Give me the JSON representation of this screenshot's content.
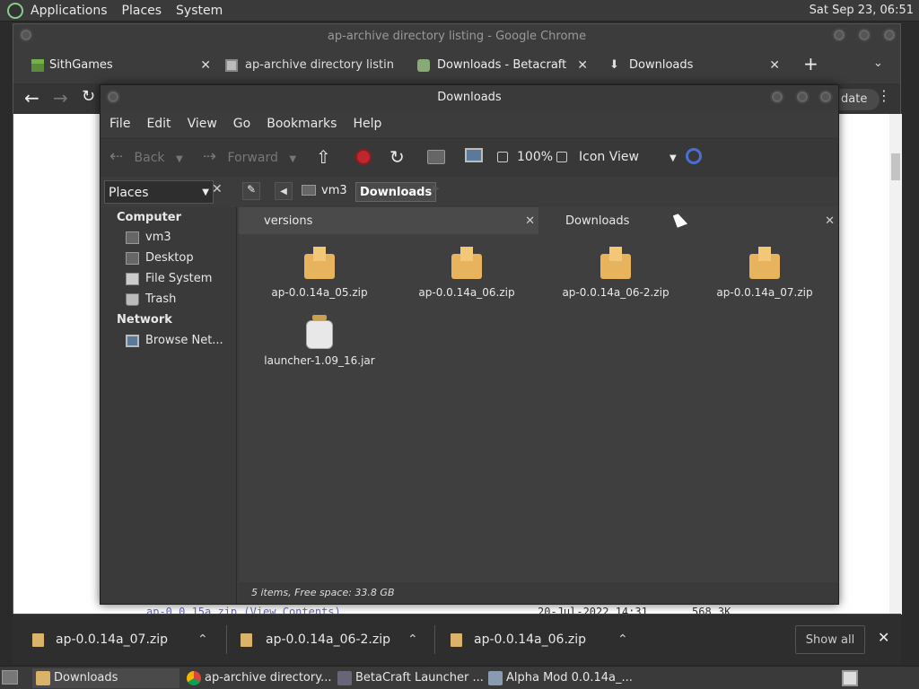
{
  "top_panel": {
    "menus": [
      "Applications",
      "Places",
      "System"
    ],
    "clock": "Sat Sep 23, 06:51"
  },
  "chrome": {
    "title": "ap-archive directory listing - Google Chrome",
    "tabs": [
      {
        "label": "SithGames",
        "icon": "minecraft-block-icon"
      },
      {
        "label": "ap-archive directory listin",
        "icon": "archive-icon"
      },
      {
        "label": "Downloads - Betacraft",
        "icon": "betacraft-icon"
      },
      {
        "label": "Downloads",
        "icon": "download-icon"
      }
    ],
    "update_label": "date",
    "page_peek": {
      "link": "ap-0.0.15a.zip (View Contents)",
      "date": "20-Jul-2022 14:31",
      "size": "568.3K"
    }
  },
  "downloads_bar": {
    "items": [
      "ap-0.0.14a_07.zip",
      "ap-0.0.14a_06-2.zip",
      "ap-0.0.14a_06.zip"
    ],
    "show_all": "Show all"
  },
  "taskbar": {
    "items": [
      "Downloads",
      "ap-archive directory...",
      "BetaCraft Launcher ...",
      "Alpha Mod 0.0.14a_..."
    ]
  },
  "caja": {
    "title": "Downloads",
    "menu": [
      "File",
      "Edit",
      "View",
      "Go",
      "Bookmarks",
      "Help"
    ],
    "toolbar": {
      "back": "Back",
      "forward": "Forward",
      "zoom": "100%",
      "view": "Icon View"
    },
    "path": [
      "vm3",
      "Downloads"
    ],
    "sidebar": {
      "places_label": "Places",
      "computer": "Computer",
      "computer_items": [
        "vm3",
        "Desktop",
        "File System",
        "Trash"
      ],
      "network": "Network",
      "network_items": [
        "Browse Net..."
      ]
    },
    "tabs": [
      "versions",
      "Downloads"
    ],
    "files": [
      {
        "name": "ap-0.0.14a_05.zip",
        "type": "zip"
      },
      {
        "name": "ap-0.0.14a_06.zip",
        "type": "zip"
      },
      {
        "name": "ap-0.0.14a_06-2.zip",
        "type": "zip"
      },
      {
        "name": "ap-0.0.14a_07.zip",
        "type": "zip"
      },
      {
        "name": "launcher-1.09_16.jar",
        "type": "jar"
      }
    ],
    "status": "5 items, Free space: 33.8 GB"
  }
}
